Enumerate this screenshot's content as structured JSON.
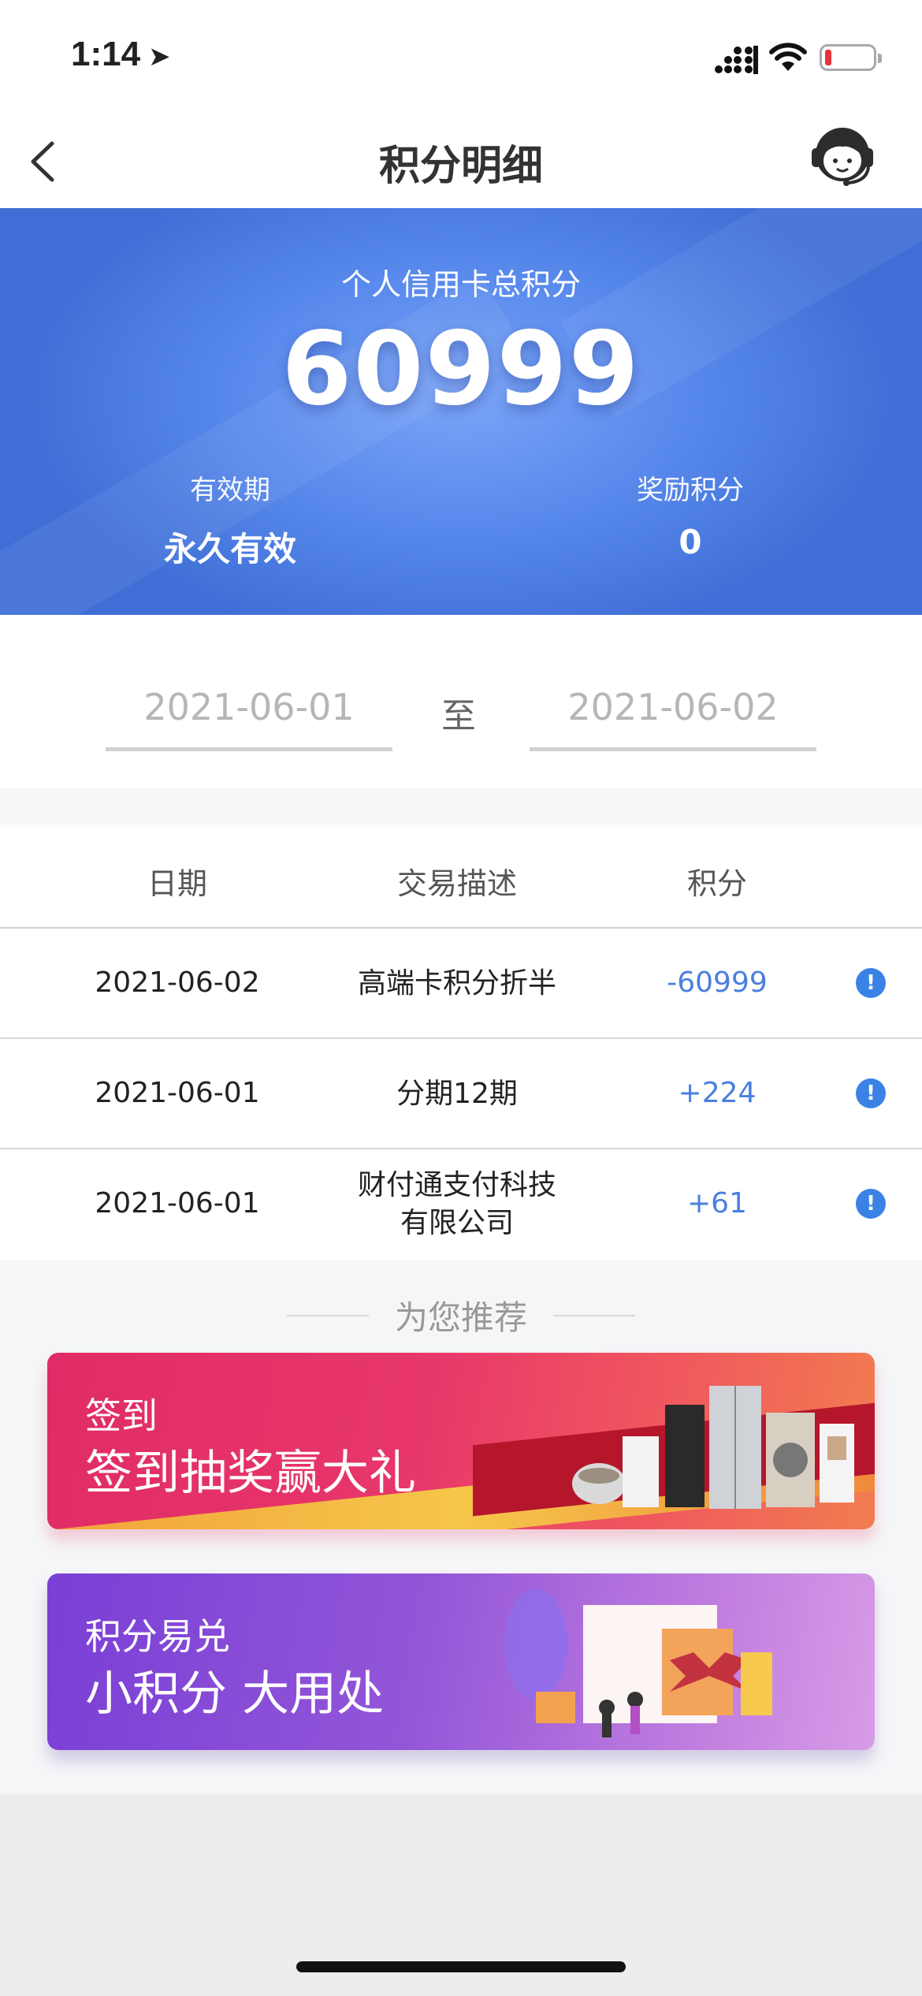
{
  "status_bar": {
    "time": "1:14"
  },
  "nav": {
    "title": "积分明细"
  },
  "summary": {
    "caption": "个人信用卡总积分",
    "total": "60999",
    "validity_label": "有效期",
    "validity_value": "永久有效",
    "bonus_label": "奖励积分",
    "bonus_value": "0"
  },
  "date_range": {
    "start": "2021-06-01",
    "separator": "至",
    "end": "2021-06-02"
  },
  "table": {
    "headers": [
      "日期",
      "交易描述",
      "积分"
    ],
    "rows": [
      {
        "date": "2021-06-02",
        "desc": "高端卡积分折半",
        "points": "-60999"
      },
      {
        "date": "2021-06-01",
        "desc": "分期12期",
        "points": "+224"
      },
      {
        "date": "2021-06-01",
        "desc": "财付通支付科技有限公司",
        "points": "+61"
      }
    ]
  },
  "recommend": {
    "title": "为您推荐",
    "banners": [
      {
        "small": "签到",
        "big": "签到抽奖赢大礼"
      },
      {
        "small": "积分易兑",
        "big": "小积分 大用处"
      }
    ]
  },
  "colors": {
    "hero_blue": "#5b8cee",
    "points_blue": "#4a7fe0",
    "banner1": "#e02c66",
    "banner2": "#8a4ad8"
  },
  "icons": [
    "location-arrow-icon",
    "signal-icon",
    "wifi-icon",
    "battery-icon",
    "back-chevron-icon",
    "customer-service-icon",
    "info-icon"
  ]
}
